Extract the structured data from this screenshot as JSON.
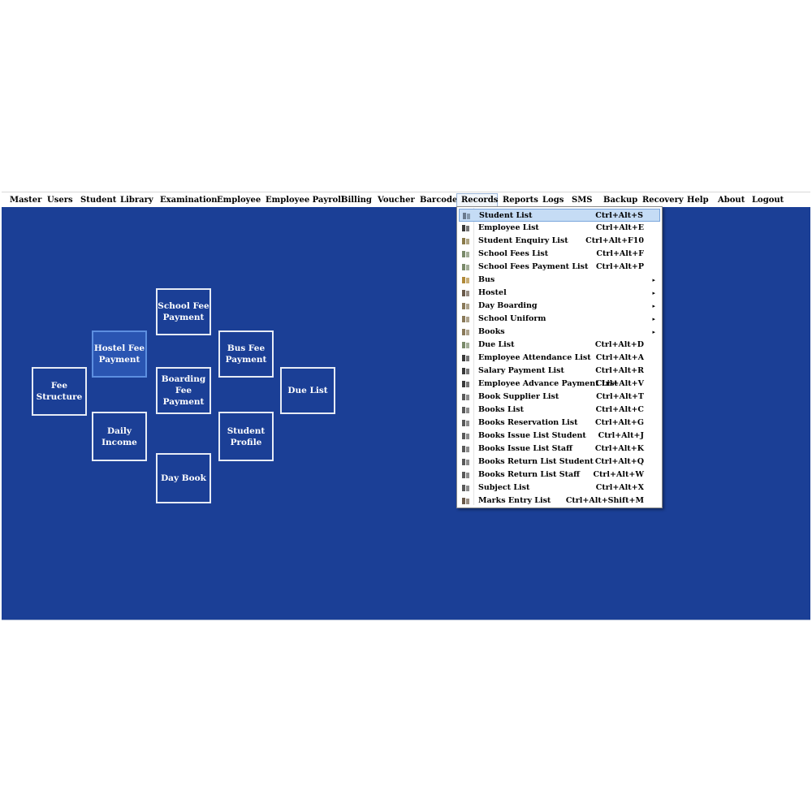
{
  "menubar": {
    "items": [
      "Master",
      "Users",
      "Student",
      "Library",
      "Examination",
      "Employee",
      "Employee Payroll",
      "Billing",
      "Voucher",
      "Barcode",
      "Records",
      "Reports",
      "Logs",
      "SMS",
      "Backup",
      "Recovery",
      "Help",
      "About",
      "Logout"
    ],
    "active": "Records"
  },
  "tiles": {
    "school_fee_payment": "School Fee\nPayment",
    "hostel_fee_payment": "Hostel Fee\nPayment",
    "bus_fee_payment": "Bus Fee\nPayment",
    "fee_structure": "Fee\nStructure",
    "boarding_fee_payment": "Boarding\nFee\nPayment",
    "due_list": "Due List",
    "daily_income": "Daily\nIncome",
    "student_profile": "Student\nProfile",
    "day_book": "Day Book"
  },
  "records_menu": {
    "items": [
      {
        "label": "Student List",
        "shortcut": "Ctrl+Alt+S",
        "icon": "student-icon"
      },
      {
        "label": "Employee List",
        "shortcut": "Ctrl+Alt+E",
        "icon": "employee-icon"
      },
      {
        "label": "Student Enquiry List",
        "shortcut": "Ctrl+Alt+F10",
        "icon": "enquiry-icon"
      },
      {
        "label": "School Fees List",
        "shortcut": "Ctrl+Alt+F",
        "icon": "fees-icon"
      },
      {
        "label": "School Fees Payment List",
        "shortcut": "Ctrl+Alt+P",
        "icon": "fees-icon"
      },
      {
        "label": "Bus",
        "shortcut": "",
        "icon": "bus-icon",
        "submenu": "▸"
      },
      {
        "label": "Hostel",
        "shortcut": "",
        "icon": "hostel-icon",
        "submenu": "▸"
      },
      {
        "label": "Day Boarding",
        "shortcut": "",
        "icon": "boarding-icon",
        "submenu": "▸"
      },
      {
        "label": "School Uniform",
        "shortcut": "",
        "icon": "uniform-icon",
        "submenu": "▸"
      },
      {
        "label": "Books",
        "shortcut": "",
        "icon": "books-icon",
        "submenu": "▸"
      },
      {
        "label": "Due List",
        "shortcut": "Ctrl+Alt+D",
        "icon": "fees-icon"
      },
      {
        "label": "Employee Attendance List",
        "shortcut": "Ctrl+Alt+A",
        "icon": "employee-icon"
      },
      {
        "label": "Salary Payment List",
        "shortcut": "Ctrl+Alt+R",
        "icon": "employee-icon"
      },
      {
        "label": "Employee Advance Payment List",
        "shortcut": "Ctrl+Alt+V",
        "icon": "employee-icon"
      },
      {
        "label": "Book Supplier List",
        "shortcut": "Ctrl+Alt+T",
        "icon": "book-icon"
      },
      {
        "label": "Books List",
        "shortcut": "Ctrl+Alt+C",
        "icon": "book-icon"
      },
      {
        "label": "Books Reservation List",
        "shortcut": "Ctrl+Alt+G",
        "icon": "book-icon"
      },
      {
        "label": "Books Issue List Student",
        "shortcut": "Ctrl+Alt+J",
        "icon": "book-icon"
      },
      {
        "label": "Books Issue List Staff",
        "shortcut": "Ctrl+Alt+K",
        "icon": "book-icon"
      },
      {
        "label": "Books Return List Student",
        "shortcut": "Ctrl+Alt+Q",
        "icon": "book-icon"
      },
      {
        "label": "Books Return List Staff",
        "shortcut": "Ctrl+Alt+W",
        "icon": "book-icon"
      },
      {
        "label": "Subject List",
        "shortcut": "Ctrl+Alt+X",
        "icon": "book-icon"
      },
      {
        "label": "Marks Entry List",
        "shortcut": "Ctrl+Alt+Shift+M",
        "icon": "marks-icon"
      }
    ],
    "selected_index": 0
  },
  "colors": {
    "workarea": "#1b3f96",
    "tile_border": "#e6ebf5",
    "highlight": "#c5dcf5"
  }
}
